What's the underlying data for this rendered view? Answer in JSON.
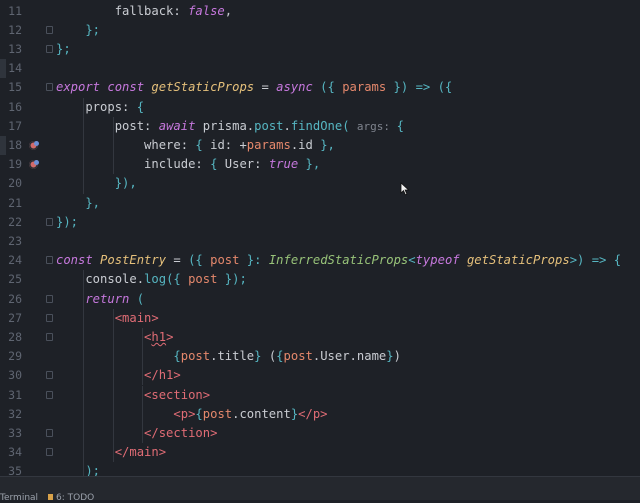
{
  "editor": {
    "lines": [
      {
        "n": "11",
        "tokens": [
          [
            "t",
            "        fallback: "
          ],
          [
            "bool",
            "false"
          ],
          [
            "t",
            ","
          ]
        ]
      },
      {
        "n": "12",
        "tokens": [
          [
            "pu",
            "    };"
          ]
        ]
      },
      {
        "n": "13",
        "tokens": [
          [
            "pu",
            "};"
          ]
        ]
      },
      {
        "n": "14",
        "tokens": []
      },
      {
        "n": "15",
        "tokens": [
          [
            "kw",
            "export const "
          ],
          [
            "fn",
            "getStaticProps"
          ],
          [
            "t",
            " = "
          ],
          [
            "kw",
            "async"
          ],
          [
            "pu",
            " ({ "
          ],
          [
            "pm",
            "params"
          ],
          [
            "pu",
            " }) => ({"
          ]
        ]
      },
      {
        "n": "16",
        "tokens": [
          [
            "t",
            "    props: "
          ],
          [
            "pu",
            "{"
          ]
        ]
      },
      {
        "n": "17",
        "tokens": [
          [
            "t",
            "        post: "
          ],
          [
            "kw",
            "await "
          ],
          [
            "t",
            "prisma."
          ],
          [
            "pr",
            "post"
          ],
          [
            "t",
            "."
          ],
          [
            "pr",
            "findOne"
          ],
          [
            "pu",
            "( "
          ],
          [
            "hint",
            "args: "
          ],
          [
            "pu",
            "{"
          ]
        ]
      },
      {
        "n": "18",
        "tokens": [
          [
            "t",
            "            where: "
          ],
          [
            "pu",
            "{ "
          ],
          [
            "t",
            "id: +"
          ],
          [
            "pm",
            "params"
          ],
          [
            "t",
            ".id "
          ],
          [
            "pu",
            "},"
          ]
        ]
      },
      {
        "n": "19",
        "tokens": [
          [
            "t",
            "            include: "
          ],
          [
            "pu",
            "{ "
          ],
          [
            "t",
            "User: "
          ],
          [
            "bool",
            "true"
          ],
          [
            "pu",
            " },"
          ]
        ]
      },
      {
        "n": "20",
        "tokens": [
          [
            "pu",
            "        }),"
          ]
        ]
      },
      {
        "n": "21",
        "tokens": [
          [
            "pu",
            "    },"
          ]
        ]
      },
      {
        "n": "22",
        "tokens": [
          [
            "pu",
            "});"
          ]
        ]
      },
      {
        "n": "23",
        "tokens": []
      },
      {
        "n": "24",
        "tokens": [
          [
            "kw",
            "const "
          ],
          [
            "fn",
            "PostEntry"
          ],
          [
            "t",
            " = "
          ],
          [
            "pu",
            "({ "
          ],
          [
            "pm",
            "post"
          ],
          [
            "pu",
            " }: "
          ],
          [
            "ty",
            "InferredStaticProps"
          ],
          [
            "pu",
            "<"
          ],
          [
            "kw",
            "typeof "
          ],
          [
            "fn",
            "getStaticProps"
          ],
          [
            "pu",
            ">) => {"
          ]
        ]
      },
      {
        "n": "25",
        "tokens": [
          [
            "t",
            "    console."
          ],
          [
            "pr",
            "log"
          ],
          [
            "pu",
            "({ "
          ],
          [
            "pm",
            "post"
          ],
          [
            "pu",
            " });"
          ]
        ]
      },
      {
        "n": "26",
        "tokens": [
          [
            "kw",
            "    return "
          ],
          [
            "pu",
            "("
          ]
        ]
      },
      {
        "n": "27",
        "tokens": [
          [
            "tg",
            "        <main>"
          ]
        ]
      },
      {
        "n": "28",
        "tokens": [
          [
            "tg",
            "            <"
          ],
          [
            "tgb",
            "h1"
          ],
          [
            "tg",
            ">"
          ]
        ]
      },
      {
        "n": "29",
        "tokens": [
          [
            "pu",
            "                {"
          ],
          [
            "pm",
            "post"
          ],
          [
            "t",
            ".title"
          ],
          [
            "pu",
            "}"
          ],
          [
            "t",
            " ("
          ],
          [
            "pu",
            "{"
          ],
          [
            "pm",
            "post"
          ],
          [
            "t",
            ".User.name"
          ],
          [
            "pu",
            "}"
          ],
          [
            "t",
            ")"
          ]
        ]
      },
      {
        "n": "30",
        "tokens": [
          [
            "tg",
            "            </h1>"
          ]
        ]
      },
      {
        "n": "31",
        "tokens": [
          [
            "tg",
            "            <section>"
          ]
        ]
      },
      {
        "n": "32",
        "tokens": [
          [
            "tg",
            "                <p>"
          ],
          [
            "pu",
            "{"
          ],
          [
            "pm",
            "post"
          ],
          [
            "t",
            ".content"
          ],
          [
            "pu",
            "}"
          ],
          [
            "tg",
            "</p>"
          ]
        ]
      },
      {
        "n": "33",
        "tokens": [
          [
            "tg",
            "            </section>"
          ]
        ]
      },
      {
        "n": "34",
        "tokens": [
          [
            "tg",
            "        </main>"
          ]
        ]
      },
      {
        "n": "35",
        "tokens": [
          [
            "pu",
            "    );"
          ]
        ]
      }
    ],
    "breakpoint_lines": [
      "18",
      "19"
    ],
    "fold_marker_lines": [
      "12",
      "13",
      "15",
      "22",
      "24",
      "26",
      "27",
      "28",
      "30",
      "31",
      "33",
      "34"
    ],
    "gutter_marks": [
      "14",
      "18"
    ]
  },
  "statusbar": {
    "terminal_label": "Terminal",
    "todo_label": "6: TODO"
  },
  "colors": {
    "background": "#1e2127",
    "keyword": "#c678dd",
    "function": "#e5c07b",
    "type": "#98c379",
    "param": "#e5886c",
    "punct": "#56b6c2",
    "tag": "#e06c75"
  }
}
